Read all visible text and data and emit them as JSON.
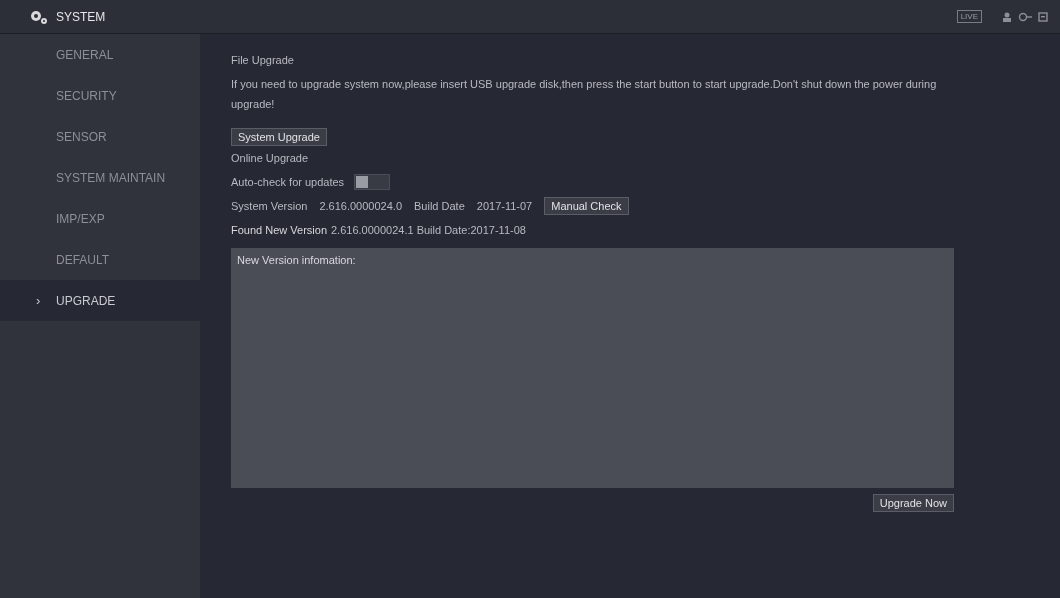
{
  "header": {
    "title": "SYSTEM",
    "live_badge": "LIVE"
  },
  "sidebar": {
    "items": [
      {
        "label": "GENERAL",
        "selected": false
      },
      {
        "label": "SECURITY",
        "selected": false
      },
      {
        "label": "SENSOR",
        "selected": false
      },
      {
        "label": "SYSTEM MAINTAIN",
        "selected": false
      },
      {
        "label": "IMP/EXP",
        "selected": false
      },
      {
        "label": "DEFAULT",
        "selected": false
      },
      {
        "label": "UPGRADE",
        "selected": true,
        "marker": "›"
      }
    ]
  },
  "file_upgrade": {
    "heading": "File Upgrade",
    "notice": "If you need to upgrade system now,please insert USB upgrade disk,then press the start button to start upgrade.Don't shut down the power during upgrade!",
    "button": "System Upgrade"
  },
  "online_upgrade": {
    "heading": "Online Upgrade",
    "auto_check": {
      "label": "Auto-check for updates",
      "on": false
    },
    "system_version_label": "System Version",
    "system_version": "2.616.0000024.0",
    "build_date_label": "Build Date",
    "build_date": "2017-11-07",
    "manual_check_button": "Manual Check",
    "found_label": "Found New Version",
    "found_info": "2.616.0000024.1 Build Date:2017-11-08",
    "info_box": "New Version infomation:",
    "upgrade_button": "Upgrade Now"
  }
}
